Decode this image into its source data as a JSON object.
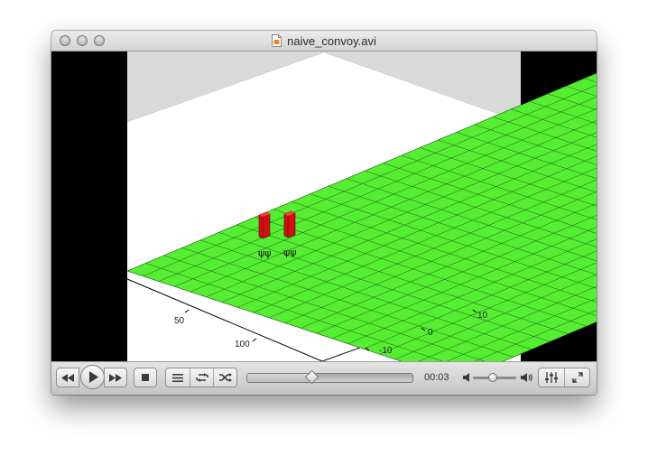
{
  "window": {
    "title": "naive_convoy.avi",
    "traffic_lights": [
      "close-button",
      "minimize-button",
      "zoom-button"
    ]
  },
  "video": {
    "scene": {
      "x_ticks": [
        "50",
        "100"
      ],
      "y_ticks": [
        "10",
        "0",
        "-10"
      ],
      "colors": {
        "floor": "#d9d9d9",
        "ground": "#ffffff",
        "grid": "#55ee33",
        "grid_lines": "#1f5a12",
        "vehicle": "#d01010"
      }
    }
  },
  "controls": {
    "rewind_icon": "rewind-icon",
    "play_icon": "play-icon",
    "forward_icon": "fast-forward-icon",
    "stop_icon": "stop-icon",
    "playlist_icon": "playlist-icon",
    "loop_icon": "loop-icon",
    "shuffle_icon": "shuffle-icon",
    "time": "00:03",
    "progress_fraction": 0.39,
    "volume_fraction": 0.45,
    "volume_low_icon": "volume-low-icon",
    "volume_high_icon": "volume-high-icon",
    "equalizer_icon": "equalizer-icon",
    "fullscreen_icon": "fullscreen-icon"
  }
}
